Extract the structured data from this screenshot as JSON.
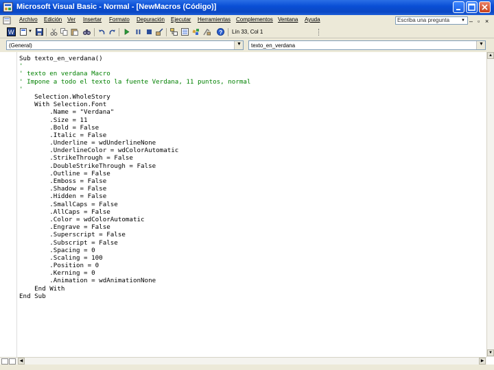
{
  "window": {
    "title": "Microsoft Visual Basic - Normal - [NewMacros (Código)]"
  },
  "menubar": {
    "items": [
      "Archivo",
      "Edición",
      "Ver",
      "Insertar",
      "Formato",
      "Depuración",
      "Ejecutar",
      "Herramientas",
      "Complementos",
      "Ventana",
      "Ayuda"
    ],
    "ask_placeholder": "Escriba una pregunta"
  },
  "toolbar": {
    "position_label": "Lín 33, Col 1"
  },
  "combos": {
    "object": "(General)",
    "procedure": "texto_en_verdana"
  },
  "code": {
    "lines": [
      {
        "text": "Sub texto_en_verdana()",
        "type": "code"
      },
      {
        "text": "'",
        "type": "comment"
      },
      {
        "text": "' texto en verdana Macro",
        "type": "comment"
      },
      {
        "text": "' Impone a todo el texto la fuente Verdana, 11 puntos, normal",
        "type": "comment"
      },
      {
        "text": "'",
        "type": "comment"
      },
      {
        "text": "    Selection.WholeStory",
        "type": "code"
      },
      {
        "text": "    With Selection.Font",
        "type": "code"
      },
      {
        "text": "        .Name = \"Verdana\"",
        "type": "code"
      },
      {
        "text": "        .Size = 11",
        "type": "code"
      },
      {
        "text": "        .Bold = False",
        "type": "code"
      },
      {
        "text": "        .Italic = False",
        "type": "code"
      },
      {
        "text": "        .Underline = wdUnderlineNone",
        "type": "code"
      },
      {
        "text": "        .UnderlineColor = wdColorAutomatic",
        "type": "code"
      },
      {
        "text": "        .StrikeThrough = False",
        "type": "code"
      },
      {
        "text": "        .DoubleStrikeThrough = False",
        "type": "code"
      },
      {
        "text": "        .Outline = False",
        "type": "code"
      },
      {
        "text": "        .Emboss = False",
        "type": "code"
      },
      {
        "text": "        .Shadow = False",
        "type": "code"
      },
      {
        "text": "        .Hidden = False",
        "type": "code"
      },
      {
        "text": "        .SmallCaps = False",
        "type": "code"
      },
      {
        "text": "        .AllCaps = False",
        "type": "code"
      },
      {
        "text": "        .Color = wdColorAutomatic",
        "type": "code"
      },
      {
        "text": "        .Engrave = False",
        "type": "code"
      },
      {
        "text": "        .Superscript = False",
        "type": "code"
      },
      {
        "text": "        .Subscript = False",
        "type": "code"
      },
      {
        "text": "        .Spacing = 0",
        "type": "code"
      },
      {
        "text": "        .Scaling = 100",
        "type": "code"
      },
      {
        "text": "        .Position = 0",
        "type": "code"
      },
      {
        "text": "        .Kerning = 0",
        "type": "code"
      },
      {
        "text": "        .Animation = wdAnimationNone",
        "type": "code"
      },
      {
        "text": "    End With",
        "type": "code"
      },
      {
        "text": "End Sub",
        "type": "code"
      }
    ]
  },
  "colors": {
    "titlebar": "#0a4fd6",
    "comment": "#008000",
    "chrome": "#ece9d8"
  },
  "icons": [
    "vb-app-icon",
    "minimize-icon",
    "restore-icon",
    "close-icon",
    "word-icon",
    "insert-module-icon",
    "save-icon",
    "cut-icon",
    "copy-icon",
    "paste-icon",
    "find-icon",
    "undo-icon",
    "redo-icon",
    "run-icon",
    "break-icon",
    "reset-icon",
    "design-mode-icon",
    "project-explorer-icon",
    "properties-icon",
    "object-browser-icon",
    "toolbox-icon",
    "help-icon"
  ]
}
